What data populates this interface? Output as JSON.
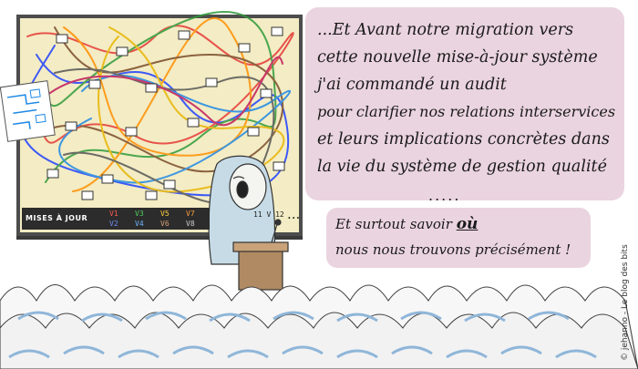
{
  "caption": {
    "lines": [
      "...Et Avant notre migration vers",
      "cette nouvelle mise-à-jour système",
      "j'ai commandé un audit",
      "pour clarifier nos relations interservices",
      "et leurs implications concrètes dans",
      "la vie du système de gestion qualité"
    ],
    "dots": "....."
  },
  "speech": {
    "lead": "...",
    "line1_prefix": "Et surtout savoir",
    "line1_emphasis": "où",
    "line2": "nous nous trouvons précisément !"
  },
  "screen": {
    "legend_title": "MISES À JOUR",
    "versions": [
      "V1",
      "V2",
      "V3",
      "V4",
      "V5",
      "V6",
      "V7",
      "V8"
    ],
    "version_colors": [
      "#e53935",
      "#1e40ff",
      "#2e9a3a",
      "#1e88e5",
      "#e8b400",
      "#7a4a2a",
      "#ff6f00",
      "#555555"
    ],
    "slide_label": "11 V 12"
  },
  "credit": "© jehanno - Le blog des bits"
}
